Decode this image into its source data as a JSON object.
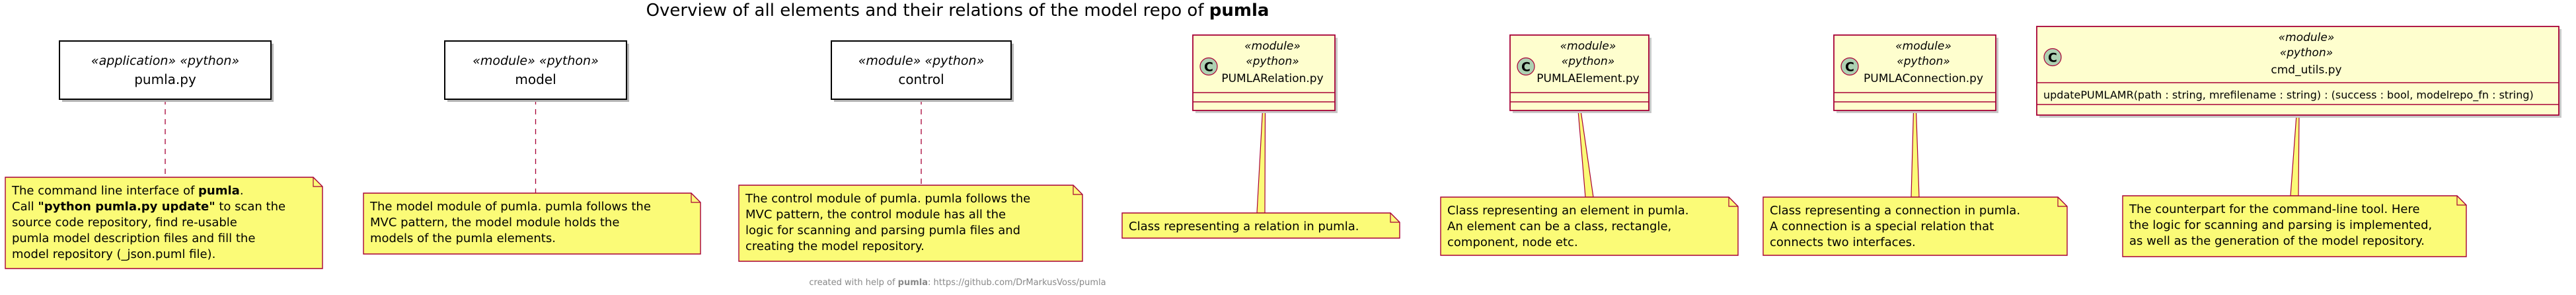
{
  "title": {
    "prefix": "Overview of all elements and their relations of the model repo of ",
    "name": "pumla"
  },
  "footer": {
    "prefix": "created with help of ",
    "name": "pumla",
    "suffix": ": https://github.com/DrMarkusVoss/pumla"
  },
  "colors": {
    "class_fill": "#FEFECE",
    "class_border": "#A80036",
    "note_fill": "#FBFB77",
    "note_border": "#A80036",
    "circle_fill": "#ADD1B2",
    "text": "#000000",
    "footer_text": "#888888"
  },
  "elements": [
    {
      "id": "pumla_py",
      "kind": "component",
      "stereotype": "«application» «python»",
      "name": "pumla.py",
      "note": [
        [
          {
            "t": "The command line interface of "
          },
          {
            "t": "pumla",
            "b": true
          },
          {
            "t": "."
          }
        ],
        [
          {
            "t": "Call "
          },
          {
            "t": "\"python pumla.py update\"",
            "b": true
          },
          {
            "t": " to scan the"
          }
        ],
        [
          {
            "t": "source code repository, find re-usable"
          }
        ],
        [
          {
            "t": "pumla model description files and fill the"
          }
        ],
        [
          {
            "t": "model repository (_json.puml file)."
          }
        ]
      ]
    },
    {
      "id": "model",
      "kind": "component",
      "stereotype": "«module» «python»",
      "name": "model",
      "note": [
        [
          {
            "t": "The model module of pumla. pumla follows the"
          }
        ],
        [
          {
            "t": "MVC pattern, the model module holds  the"
          }
        ],
        [
          {
            "t": "models of the pumla elements."
          }
        ]
      ]
    },
    {
      "id": "control",
      "kind": "component",
      "stereotype": "«module» «python»",
      "name": "control",
      "note": [
        [
          {
            "t": "The control module of pumla. pumla follows the"
          }
        ],
        [
          {
            "t": "MVC pattern, the control module has all the"
          }
        ],
        [
          {
            "t": "logic for scanning and parsing pumla files and"
          }
        ],
        [
          {
            "t": "creating the model repository."
          }
        ]
      ]
    },
    {
      "id": "pumla_relation",
      "kind": "class",
      "circle": "C",
      "stereotypes": [
        "«module»",
        "«python»"
      ],
      "name": "PUMLARelation.py",
      "members": [],
      "note": [
        [
          {
            "t": "Class representing a relation in pumla."
          }
        ]
      ]
    },
    {
      "id": "pumla_element",
      "kind": "class",
      "circle": "C",
      "stereotypes": [
        "«module»",
        "«python»"
      ],
      "name": "PUMLAElement.py",
      "members": [],
      "note": [
        [
          {
            "t": "Class representing an element in pumla."
          }
        ],
        [
          {
            "t": "An element can be a class, rectangle,"
          }
        ],
        [
          {
            "t": "component, node etc."
          }
        ]
      ]
    },
    {
      "id": "pumla_connection",
      "kind": "class",
      "circle": "C",
      "stereotypes": [
        "«module»",
        "«python»"
      ],
      "name": "PUMLAConnection.py",
      "members": [],
      "note": [
        [
          {
            "t": "Class representing a connection in pumla."
          }
        ],
        [
          {
            "t": "A connection is a special relation that"
          }
        ],
        [
          {
            "t": "connects two interfaces."
          }
        ]
      ]
    },
    {
      "id": "cmd_utils",
      "kind": "class",
      "circle": "C",
      "stereotypes": [
        "«module»",
        "«python»"
      ],
      "name": "cmd_utils.py",
      "members": [
        "updatePUMLAMR(path : string, mrefilename : string) : (success : bool, modelrepo_fn : string)"
      ],
      "note": [
        [
          {
            "t": "The counterpart for the command-line tool. Here"
          }
        ],
        [
          {
            "t": "the logic for scanning and parsing is implemented,"
          }
        ],
        [
          {
            "t": "as well as the generation of the model repository."
          }
        ]
      ]
    }
  ]
}
